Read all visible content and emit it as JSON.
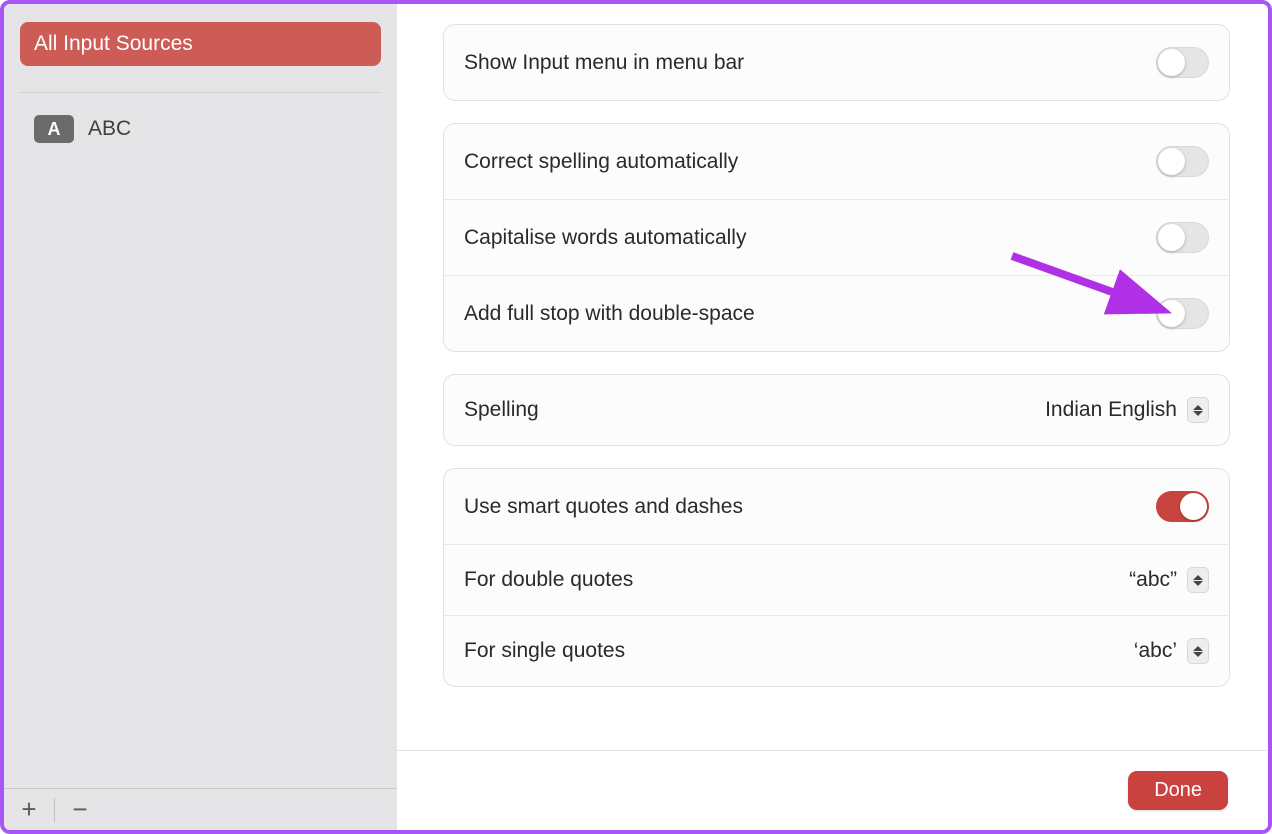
{
  "sidebar": {
    "all_sources_label": "All Input Sources",
    "items": [
      {
        "icon_letter": "A",
        "label": "ABC"
      }
    ]
  },
  "settings": {
    "group1": {
      "show_input_menu": {
        "label": "Show Input menu in menu bar",
        "on": false
      }
    },
    "group2": {
      "correct_spelling": {
        "label": "Correct spelling automatically",
        "on": false
      },
      "capitalise_words": {
        "label": "Capitalise words automatically",
        "on": false
      },
      "add_full_stop": {
        "label": "Add full stop with double-space",
        "on": false
      }
    },
    "group3": {
      "spelling": {
        "label": "Spelling",
        "value": "Indian English"
      }
    },
    "group4": {
      "smart_quotes": {
        "label": "Use smart quotes and dashes",
        "on": true
      },
      "double_quotes": {
        "label": "For double quotes",
        "value": "“abc”"
      },
      "single_quotes": {
        "label": "For single quotes",
        "value": "‘abc’"
      }
    }
  },
  "footer": {
    "done_label": "Done"
  },
  "annotation": {
    "arrow_color": "#b030e6"
  }
}
